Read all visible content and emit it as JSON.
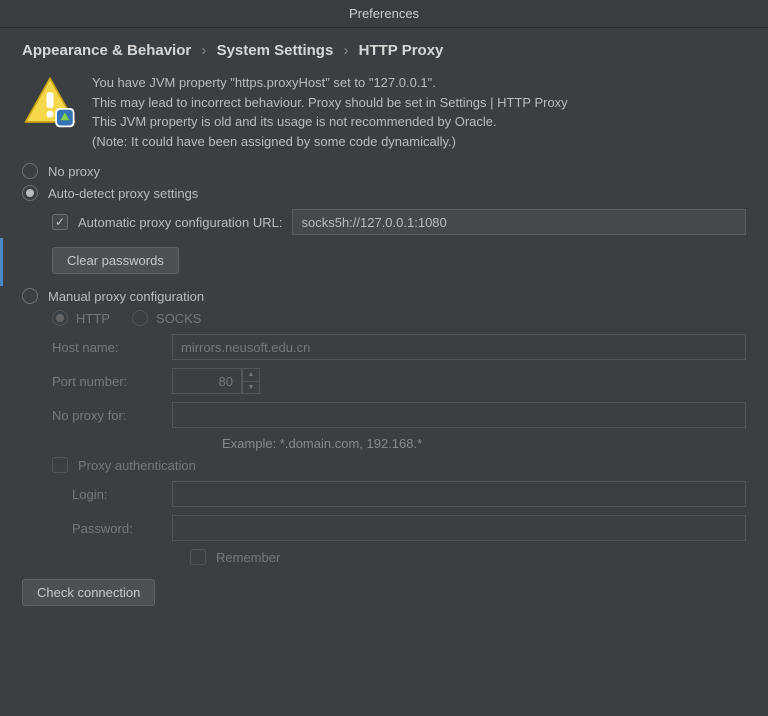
{
  "window": {
    "title": "Preferences"
  },
  "breadcrumb": {
    "part1": "Appearance & Behavior",
    "part2": "System Settings",
    "part3": "HTTP Proxy",
    "sep": "›"
  },
  "warning": {
    "line1": "You have JVM property \"https.proxyHost\" set to \"127.0.0.1\".",
    "line2": "This may lead to incorrect behaviour. Proxy should be set in Settings | HTTP Proxy",
    "line3": "This JVM property is old and its usage is not recommended by Oracle.",
    "line4": "(Note: It could have been assigned by some code dynamically.)"
  },
  "proxy": {
    "no_proxy_label": "No proxy",
    "auto_detect_label": "Auto-detect proxy settings",
    "auto_url_label": "Automatic proxy configuration URL:",
    "auto_url_value": "socks5h://127.0.0.1:1080",
    "clear_passwords_label": "Clear passwords",
    "manual_label": "Manual proxy configuration",
    "http_label": "HTTP",
    "socks_label": "SOCKS",
    "host_label": "Host name:",
    "host_value": "mirrors.neusoft.edu.cn",
    "port_label": "Port number:",
    "port_value": "80",
    "no_proxy_for_label": "No proxy for:",
    "no_proxy_for_value": "",
    "example_hint": "Example: *.domain.com, 192.168.*",
    "auth_label": "Proxy authentication",
    "login_label": "Login:",
    "login_value": "",
    "password_label": "Password:",
    "password_value": "",
    "remember_label": "Remember",
    "check_connection_label": "Check connection"
  }
}
